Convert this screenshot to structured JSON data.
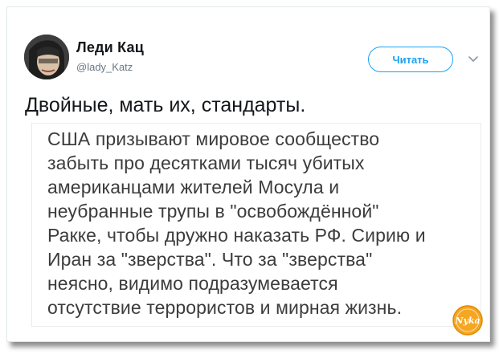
{
  "user": {
    "display_name": "Леди Кац",
    "handle": "@lady_Katz"
  },
  "follow_button": {
    "label": "Читать"
  },
  "tweet": {
    "text": "Двойные, мать их, стандарты."
  },
  "quoted_image_text": {
    "lines": [
      "США призывают мировое сообщество",
      "забыть про десятками тысяч убитых",
      "американцами жителей Мосула и",
      "неубранные трупы в \"освобождённой\"",
      "Ракке, чтобы дружно наказать РФ. Сирию и",
      "Иран за \"зверства\". Что за \"зверства\"",
      "неясно, видимо подразумевается",
      "отсутствие террористов и мирная жизнь."
    ]
  },
  "watermark": {
    "text": "Nyka"
  },
  "icons": {
    "caret": "chevron-down-icon"
  },
  "colors": {
    "accent": "#1da1f2",
    "text": "#14171a",
    "muted": "#657786",
    "watermark_fill": "#f5a623"
  }
}
